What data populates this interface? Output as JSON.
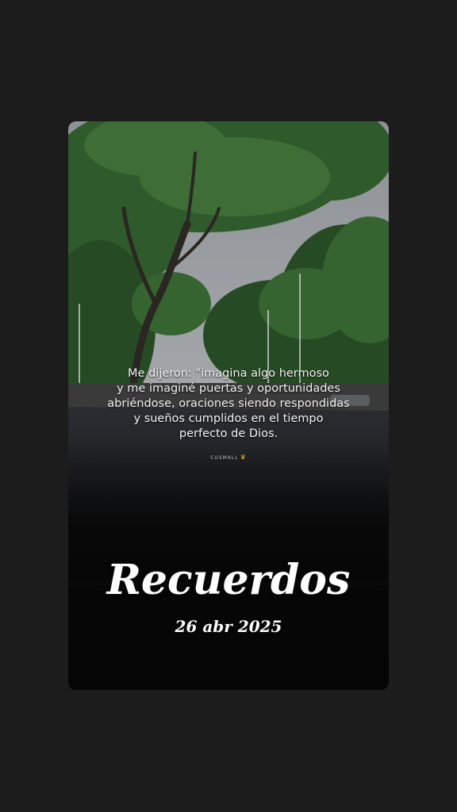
{
  "memory_card": {
    "quote_lines": [
      "Me dijeron: \"imagina algo hermoso",
      "y me imaginé puertas y oportunidades",
      "abriéndose, oraciones siendo respondidas",
      "y sueños cumplidos en el tiempo",
      "perfecto de Dios."
    ],
    "signature": "CUSMALL",
    "signature_icon": "crown-icon",
    "title": "Recuerdos",
    "date": "26 abr 2025"
  },
  "colors": {
    "background": "#1c1c1c",
    "card_bottom": "#050505",
    "text": "#ffffff",
    "crown": "#e6b422"
  }
}
